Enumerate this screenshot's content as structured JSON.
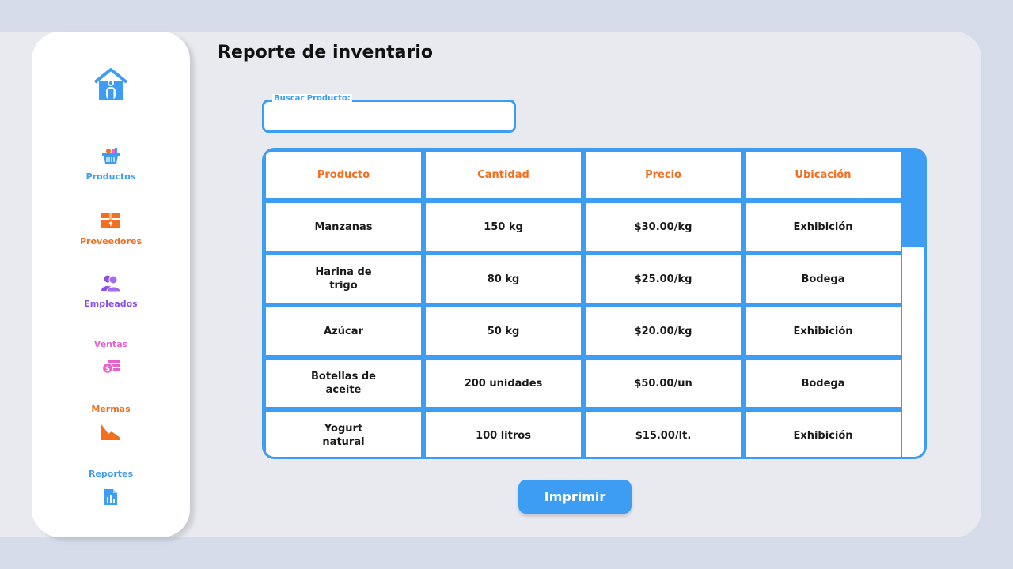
{
  "title": "Reporte de inventario",
  "colors": {
    "accent": "#3d9df2",
    "orange": "#f36f1f",
    "purple": "#8a4fe8",
    "pink": "#e95fd0"
  },
  "sidebar": {
    "home_icon": "home-icon",
    "items": [
      {
        "label": "Productos",
        "icon": "basket-icon",
        "color": "#3d9df2"
      },
      {
        "label": "Proveedores",
        "icon": "box-icon",
        "color": "#f36f1f"
      },
      {
        "label": "Empleados",
        "icon": "users-icon",
        "color": "#8a4fe8"
      },
      {
        "label": "Ventas",
        "icon": "money-icon",
        "color": "#e95fd0"
      },
      {
        "label": "Mermas",
        "icon": "decline-chart-icon",
        "color": "#f36f1f"
      },
      {
        "label": "Reportes",
        "icon": "report-icon",
        "color": "#3d9df2"
      }
    ]
  },
  "search": {
    "label": "Buscar Producto:",
    "value": "",
    "placeholder": ""
  },
  "table": {
    "headers": [
      "Producto",
      "Cantidad",
      "Precio",
      "Ubicación"
    ],
    "rows": [
      [
        "Manzanas",
        "150 kg",
        "$30.00/kg",
        "Exhibición"
      ],
      [
        "Harina de trigo",
        "80 kg",
        "$25.00/kg",
        "Bodega"
      ],
      [
        "Azúcar",
        "50 kg",
        "$20.00/kg",
        "Exhibición"
      ],
      [
        "Botellas de aceite",
        "200 unidades",
        "$50.00/un",
        "Bodega"
      ],
      [
        "Yogurt natural",
        "100 litros",
        "$15.00/lt.",
        "Exhibición"
      ]
    ]
  },
  "print_label": "Imprimir"
}
